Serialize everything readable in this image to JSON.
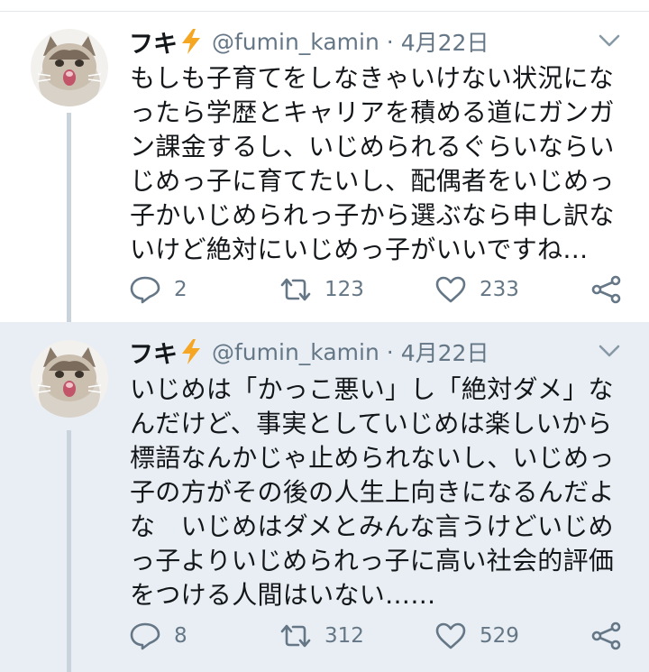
{
  "colors": {
    "text": "#14171a",
    "secondary": "#657786",
    "reply_highlight_bg": "#e8eef3",
    "thread_line": "#c8d3dc",
    "bolt": "#f5a623"
  },
  "tweets": [
    {
      "author_name": "フキ",
      "author_emoji_icon": "lightning-bolt-icon",
      "handle": "@fumin_kamin",
      "separator": "·",
      "date": "4月22日",
      "text": "もしも子育てをしなきゃいけない状況にな\nったら学歴とキャリアを積める道にガンガ\nン課金するし、いじめられるぐらいならい\nじめっ子に育てたいし、配偶者をいじめっ\n子かいじめられっ子から選ぶなら申し訳な\nいけど絶対にいじめっ子がいいですね…",
      "replies": "2",
      "retweets": "123",
      "likes": "233"
    },
    {
      "author_name": "フキ",
      "author_emoji_icon": "lightning-bolt-icon",
      "handle": "@fumin_kamin",
      "separator": "·",
      "date": "4月22日",
      "text": "いじめは「かっこ悪い」し「絶対ダメ」な\nんだけど、事実としていじめは楽しいから\n標語なんかじゃ止められないし、いじめっ\n子の方がその後の人生上向きになるんだよ\nな　いじめはダメとみんな言うけどいじめ\nっ子よりいじめられっ子に高い社会的評価\nをつける人間はいない……",
      "replies": "8",
      "retweets": "312",
      "likes": "529"
    }
  ]
}
